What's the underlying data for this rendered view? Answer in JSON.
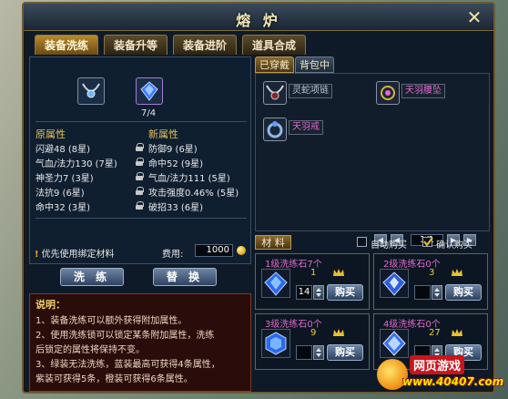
{
  "window": {
    "title": "熔 炉",
    "close_icon": "close-icon"
  },
  "tabs": [
    "装备洗练",
    "装备升等",
    "装备进阶",
    "道具合成"
  ],
  "left": {
    "equip_slot_icon": "necklace-icon",
    "stone_slot_icon": "blue-gem-icon",
    "stone_count": "7/4",
    "original_header": "原属性",
    "new_header": "新属性",
    "original_attrs": [
      "闪避48 (8星)",
      "气血/法力130 (7星)",
      "神圣力7 (3星)",
      "法抗9 (6星)",
      "命中32 (3星)"
    ],
    "new_attrs": [
      "防御9 (6星)",
      "命中52 (9星)",
      "气血/法力111 (5星)",
      "攻击强度0.46% (5星)",
      "破招33 (6星)"
    ],
    "option_label": "优先使用绑定材料",
    "fee_label": "费用:",
    "fee_value": "1000",
    "wash_button": "洗 练",
    "replace_button": "替 换"
  },
  "notes": {
    "header": "说明：",
    "lines": [
      "1、装备洗练可以额外获得附加属性。",
      "2、使用洗练锁可以锁定某条附加属性，洗练",
      "后锁定的属性将保持不变。",
      "3、绿装无法洗练，蓝装最高可获得4条属性，",
      "紫装可获得5条，橙装可获得6条属性。"
    ]
  },
  "right": {
    "tabs": [
      "已穿戴",
      "背包中"
    ],
    "items": [
      {
        "name": "灵蛇项链",
        "color": "#b9c6d6",
        "icon": "necklace-icon"
      },
      {
        "name": "天羽腰坠",
        "color": "#e06acd",
        "icon": "pendant-icon"
      },
      {
        "name": "天羽戒",
        "color": "#e06acd",
        "icon": "ring-icon"
      }
    ],
    "pager": {
      "text": "1/1"
    },
    "materials_tab": "材 料",
    "auto_buy": "自动购买",
    "confirm_buy": "确认购买",
    "materials": [
      {
        "name": "1级洗练石7个",
        "cost": "1",
        "qty": "14",
        "buy": "购买"
      },
      {
        "name": "2级洗练石0个",
        "cost": "3",
        "qty": "",
        "buy": "购买"
      },
      {
        "name": "3级洗练石0个",
        "cost": "9",
        "qty": "",
        "buy": "购买"
      },
      {
        "name": "4级洗练石0个",
        "cost": "27",
        "qty": "",
        "buy": "购买"
      }
    ]
  },
  "watermark": {
    "top": "网页游戏",
    "url": "www.40407.com"
  },
  "colors": {
    "gold": "#e4c25a",
    "purple": "#e06acd",
    "frame": "#6a5a35"
  }
}
